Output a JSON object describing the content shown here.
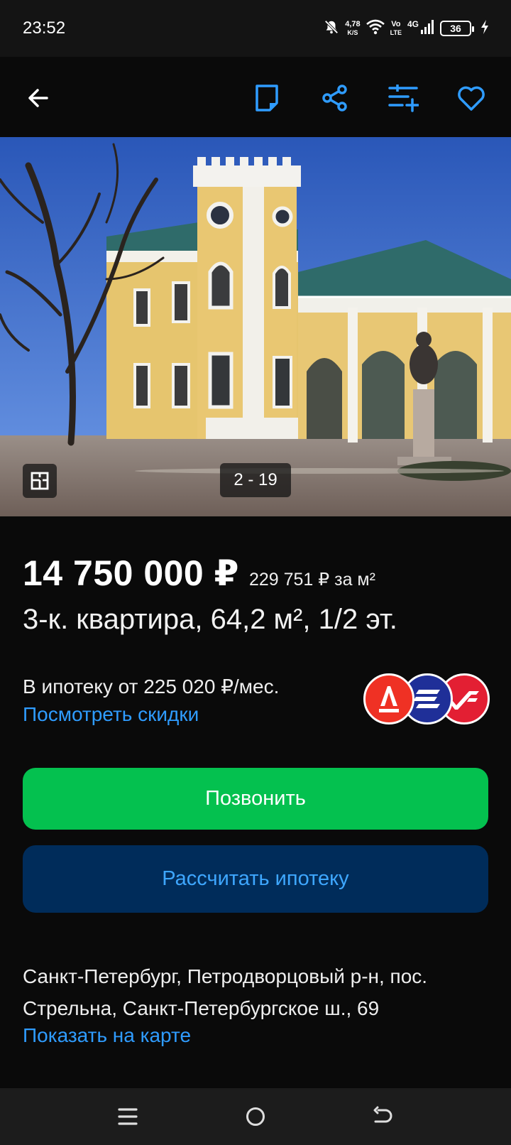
{
  "status_bar": {
    "time": "23:52",
    "net_speed_value": "4,78",
    "net_speed_unit": "K/S",
    "volte_top": "Vo",
    "volte_bottom": "LTE",
    "network": "4G",
    "battery": "36"
  },
  "app_bar": {
    "icons": [
      "back-arrow-icon",
      "note-icon",
      "share-icon",
      "compare-icon",
      "favorite-heart-icon"
    ],
    "accent": "#2f9cff"
  },
  "gallery": {
    "counter": "2 - 19"
  },
  "listing": {
    "price": "14 750 000 ₽",
    "price_per_m2": "229 751 ₽ за м²",
    "title": "3-к. квартира, 64,2 м², 1/2 эт."
  },
  "mortgage": {
    "text": "В ипотеку от 225 020 ₽/мес.",
    "discount_link": "Посмотреть скидки",
    "bank_logos": [
      "alfa-bank-logo",
      "bank-stripes-logo",
      "bank-check-logo"
    ]
  },
  "buttons": {
    "call": "Позвонить",
    "call_color": "#04c14f",
    "calc_mortgage": "Рассчитать ипотеку",
    "calc_color": "#002c5a"
  },
  "address": {
    "text": "Санкт-Петербург, Петродворцовый р-н, пос. Стрельна, Санкт-Петербургское ш., 69",
    "map_link": "Показать на карте"
  },
  "nav_bar": {
    "icons": [
      "menu-icon",
      "home-circle-icon",
      "back-icon"
    ]
  }
}
